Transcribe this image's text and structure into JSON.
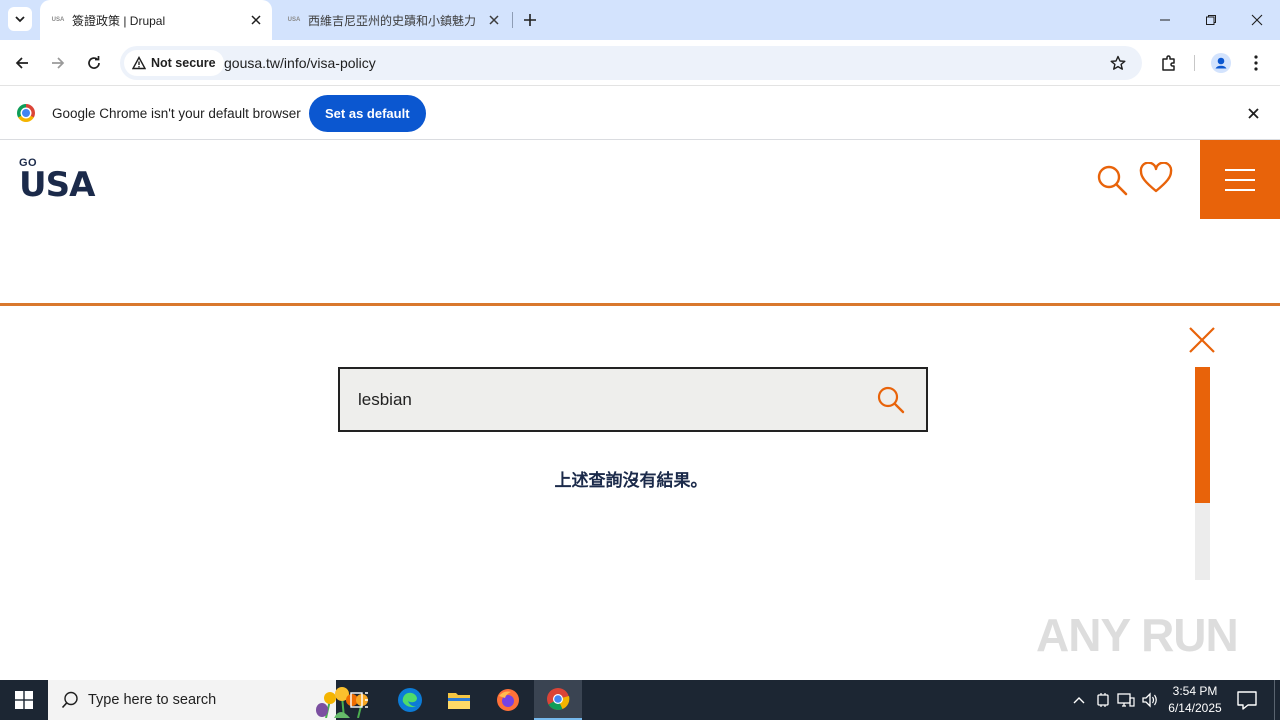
{
  "browser": {
    "tabs": [
      {
        "favicon": "USA",
        "title": "簽證政策 | Drupal",
        "active": true
      },
      {
        "favicon": "USA",
        "title": "西維吉尼亞州的史蹟和小鎮魅力",
        "active": false
      }
    ],
    "security_label": "Not secure",
    "url": "gousa.tw/info/visa-policy"
  },
  "infobar": {
    "message": "Google Chrome isn't your default browser",
    "button_label": "Set as default"
  },
  "site": {
    "logo_top": "GO",
    "logo_main": "USA"
  },
  "search": {
    "query": "lesbian",
    "no_results": "上述查詢沒有結果。",
    "scroll_progress": 0.64
  },
  "watermark": "ANY RUN",
  "taskbar": {
    "search_placeholder": "Type here to search",
    "time": "3:54 PM",
    "date": "6/14/2025"
  },
  "colors": {
    "accent": "#e8630a",
    "navy": "#1b2a4a",
    "chrome_blue": "#0b57d0",
    "tab_strip": "#d3e3fd"
  }
}
